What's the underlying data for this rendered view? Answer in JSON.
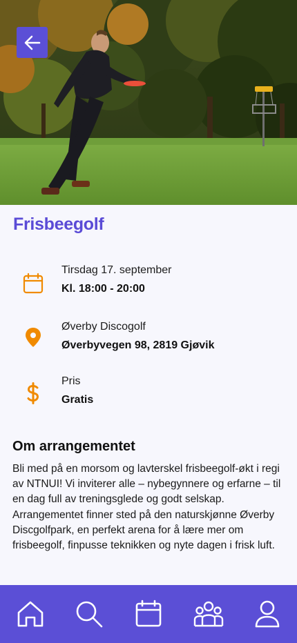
{
  "event": {
    "title": "Frisbeegolf",
    "date": {
      "day": "Tirsdag 17. september",
      "time": "Kl. 18:00 - 20:00",
      "icon": "calendar-icon"
    },
    "location": {
      "name": "Øverby Discogolf",
      "address": "Øverbyvegen 98, 2819 Gjøvik",
      "icon": "location-pin-icon"
    },
    "price": {
      "label": "Pris",
      "value": "Gratis",
      "icon": "dollar-icon"
    }
  },
  "about": {
    "heading": "Om arrangementet",
    "text": "Bli med på en morsom og lavterskel frisbeegolf-økt i regi av NTNUI! Vi inviterer alle – nybegynnere og erfarne – til en dag full av treningsglede og godt selskap. Arrangementet finner sted på den naturskjønne Øverby Discgolfpark, en perfekt arena for å lære mer om frisbeegolf, finpusse teknikken og nyte dagen i frisk luft."
  },
  "nav": {
    "items": [
      {
        "name": "home",
        "icon": "home-icon"
      },
      {
        "name": "search",
        "icon": "search-icon"
      },
      {
        "name": "calendar",
        "icon": "calendar-icon"
      },
      {
        "name": "groups",
        "icon": "group-icon"
      },
      {
        "name": "profile",
        "icon": "profile-icon"
      }
    ]
  },
  "colors": {
    "accent": "#5b4fd6",
    "title": "#5a4bd6",
    "icon_orange": "#f08a00",
    "background": "#f7f7fd"
  }
}
